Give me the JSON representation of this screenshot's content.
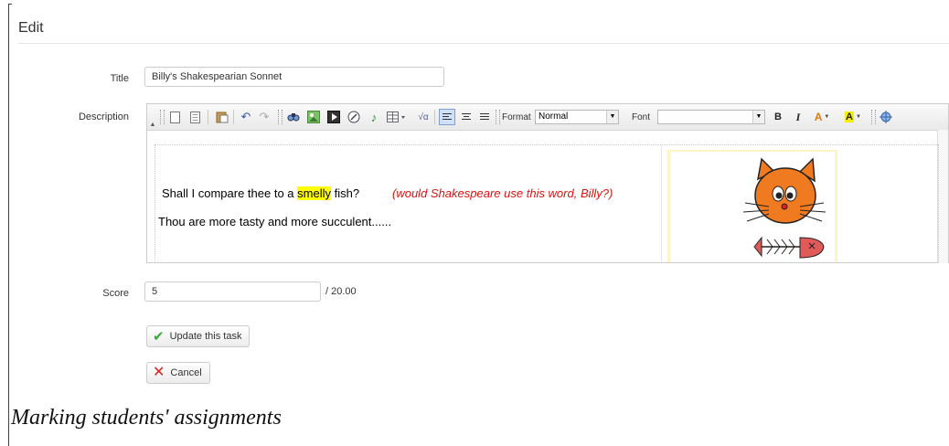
{
  "section": {
    "title": "Edit"
  },
  "form": {
    "title_label": "Title",
    "title_value": "Billy's Shakespearian Sonnet",
    "description_label": "Description",
    "score_label": "Score",
    "score_value": "5",
    "score_max": "/ 20.00"
  },
  "toolbar": {
    "format_label": "Format",
    "format_value": "Normal",
    "font_label": "Font",
    "font_value": "",
    "bold": "B",
    "italic": "I",
    "text_color": "A",
    "bg_color": "A"
  },
  "editor": {
    "line1_before": "Shall I compare thee to a ",
    "line1_highlight": "smelly",
    "line1_after": " fish?",
    "comment": "(would Shakespeare use this word, Billy?)",
    "line2": "Thou are more tasty and more succulent......",
    "highlight_color": "#ffff00",
    "comment_color": "#e01010"
  },
  "buttons": {
    "update_label": "Update this task",
    "cancel_label": "Cancel"
  },
  "caption": "Marking students' assignments"
}
